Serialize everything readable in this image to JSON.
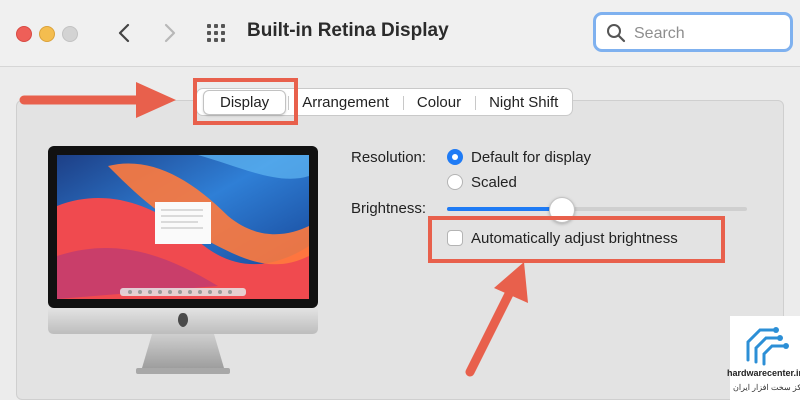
{
  "window": {
    "title": "Built-in Retina Display",
    "search_placeholder": "Search"
  },
  "tabs": [
    {
      "label": "Display",
      "selected": true
    },
    {
      "label": "Arrangement",
      "selected": false
    },
    {
      "label": "Colour",
      "selected": false
    },
    {
      "label": "Night Shift",
      "selected": false
    }
  ],
  "resolution": {
    "label": "Resolution:",
    "options": [
      {
        "label": "Default for display",
        "selected": true
      },
      {
        "label": "Scaled",
        "selected": false
      }
    ]
  },
  "brightness": {
    "label": "Brightness:",
    "value": 0.38
  },
  "auto_brightness": {
    "label": "Automatically adjust brightness",
    "checked": false
  },
  "colors": {
    "accent": "#1f7bf5",
    "annotation": "#e8604c"
  },
  "watermark": {
    "site": "hardwarecenter.ir",
    "persian": "مرکز سخت افزار ایران"
  }
}
